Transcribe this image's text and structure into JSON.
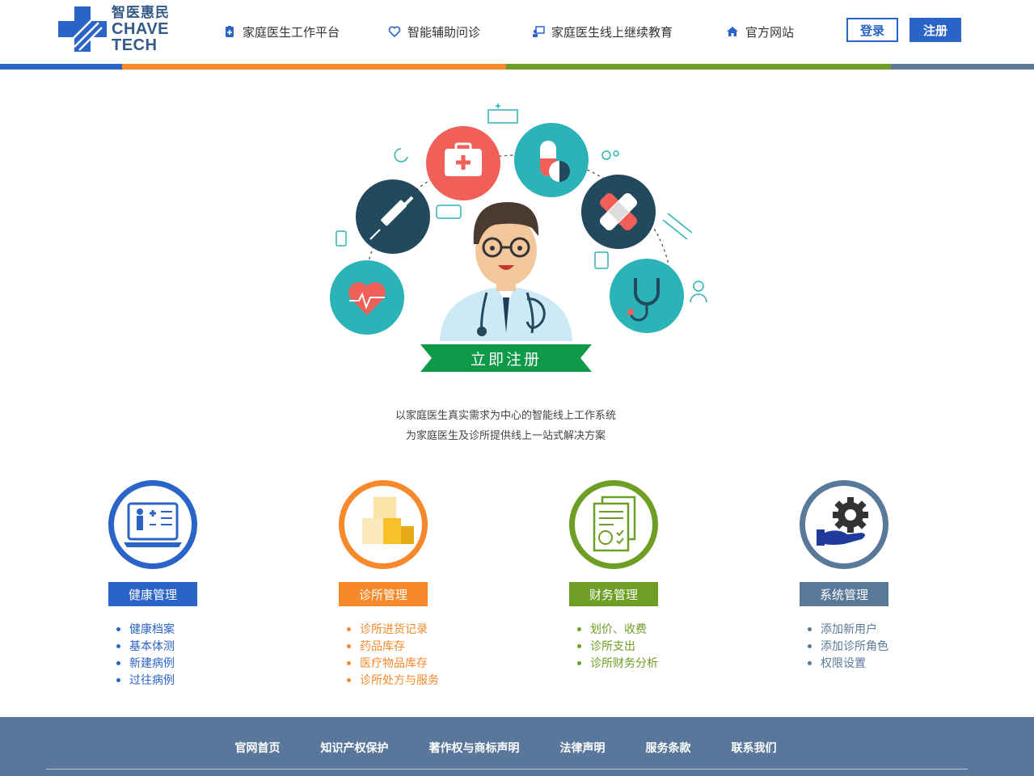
{
  "header": {
    "logo_cn": "智医惠民",
    "logo_en_line1": "CHAVE",
    "logo_en_line2": "TECH",
    "nav": [
      {
        "label": "家庭医生工作平台",
        "icon": "clipboard-plus-icon"
      },
      {
        "label": "智能辅助问诊",
        "icon": "heart-outline-icon"
      },
      {
        "label": "家庭医生线上继续教育",
        "icon": "teacher-board-icon"
      },
      {
        "label": "官方网站",
        "icon": "home-icon"
      }
    ],
    "login_label": "登录",
    "register_label": "注册"
  },
  "colors": {
    "blue": "#2b64c9",
    "orange": "#f7892a",
    "green": "#6e9e23",
    "slate": "#5a7899",
    "teal": "#2bb3b8",
    "red": "#f06059",
    "ribbon": "#0f9a49"
  },
  "hero": {
    "cta_label": "立即注册"
  },
  "tagline": {
    "line1": "以家庭医生真实需求为中心的智能线上工作系统",
    "line2": "为家庭医生及诊所提供线上一站式解决方案"
  },
  "features": [
    {
      "title": "健康管理",
      "icon": "health-record-icon",
      "items": [
        "健康档案",
        "基本体测",
        "新建病例",
        "过往病例"
      ]
    },
    {
      "title": "诊所管理",
      "icon": "boxes-icon",
      "items": [
        "诊所进货记录",
        "药品库存",
        "医疗物品库存",
        "诊所处方与服务"
      ]
    },
    {
      "title": "财务管理",
      "icon": "finance-document-icon",
      "items": [
        "划价、收费",
        "诊所支出",
        "诊所财务分析"
      ]
    },
    {
      "title": "系统管理",
      "icon": "gear-hand-icon",
      "items": [
        "添加新用户",
        "添加诊所角色",
        "权限设置"
      ]
    }
  ],
  "footer": {
    "links": [
      "官网首页",
      "知识产权保护",
      "著作权与商标声明",
      "法律声明",
      "服务条款",
      "联系我们"
    ]
  }
}
